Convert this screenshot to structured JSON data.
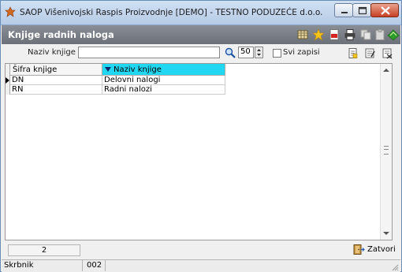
{
  "window": {
    "title": "SAOP   Višenivojski Raspis Proizvodnje [DEMO] - TESTNO PODUZEĆE d.o.o."
  },
  "header": {
    "title": "Knjige radnih naloga",
    "icons": [
      "grid-icon",
      "favorite-star-icon",
      "pdf-icon",
      "print-icon",
      "copy-icon",
      "paste-icon",
      "exit-icon"
    ]
  },
  "search": {
    "label": "Naziv knjige",
    "value": "",
    "count": "50",
    "show_all_label": "Svi zapisi",
    "show_all_checked": false,
    "actions": [
      "new-record-icon",
      "edit-record-icon",
      "delete-record-icon"
    ]
  },
  "table": {
    "columns": [
      "Šifra knjige",
      "Naziv knjige"
    ],
    "sorted_column": "Naziv knjige",
    "rows": [
      {
        "code": "DN",
        "name": "Delovni nalogi"
      },
      {
        "code": "RN",
        "name": "Radni nalozi"
      }
    ]
  },
  "footer": {
    "record_count": "2",
    "close_label": "Zatvori"
  },
  "status": {
    "user": "Skrbnik",
    "code": "002"
  },
  "colors": {
    "sorted_header": "#22d7f2",
    "header_bg": "#7b8088"
  }
}
